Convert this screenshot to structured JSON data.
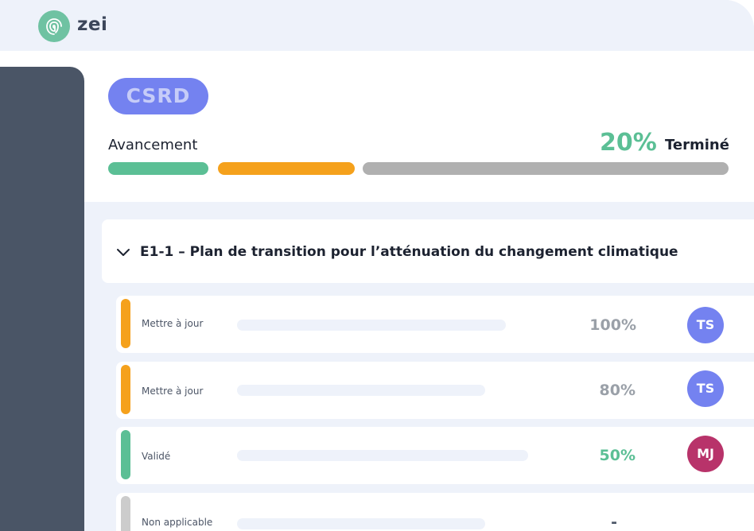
{
  "app": {
    "brand": "zei",
    "logo_icon": "fingerprint-logo-icon"
  },
  "framework": {
    "badge": "CSRD"
  },
  "progress": {
    "label": "Avancement",
    "percent_text": "20%",
    "status_text": "Terminé",
    "segments": [
      {
        "color": "#5bbf95",
        "status": "done"
      },
      {
        "color": "#f5a11c",
        "status": "in-progress"
      },
      {
        "color": "#b0b0b0",
        "status": "remaining"
      }
    ]
  },
  "section": {
    "toggle_icon": "chevron-down-icon",
    "title": "E1-1 – Plan de transition pour l’atténuation du changement climatique"
  },
  "rows": [
    {
      "status": "Mettre à jour",
      "status_color": "#f5a11c",
      "percent": "100%",
      "percent_color": "#9aa0a8",
      "assignee": "TS",
      "avatar_color": "#7482f0"
    },
    {
      "status": "Mettre à jour",
      "status_color": "#f5a11c",
      "percent": "80%",
      "percent_color": "#9aa0a8",
      "assignee": "TS",
      "avatar_color": "#7482f0"
    },
    {
      "status": "Validé",
      "status_color": "#5bbf95",
      "percent": "50%",
      "percent_color": "#5bbf95",
      "assignee": "MJ",
      "avatar_color": "#b8336a"
    },
    {
      "status": "Non applicable",
      "status_color": "#cccccc",
      "percent": "-",
      "percent_color": "#4a5566",
      "assignee": "",
      "avatar_color": ""
    }
  ]
}
